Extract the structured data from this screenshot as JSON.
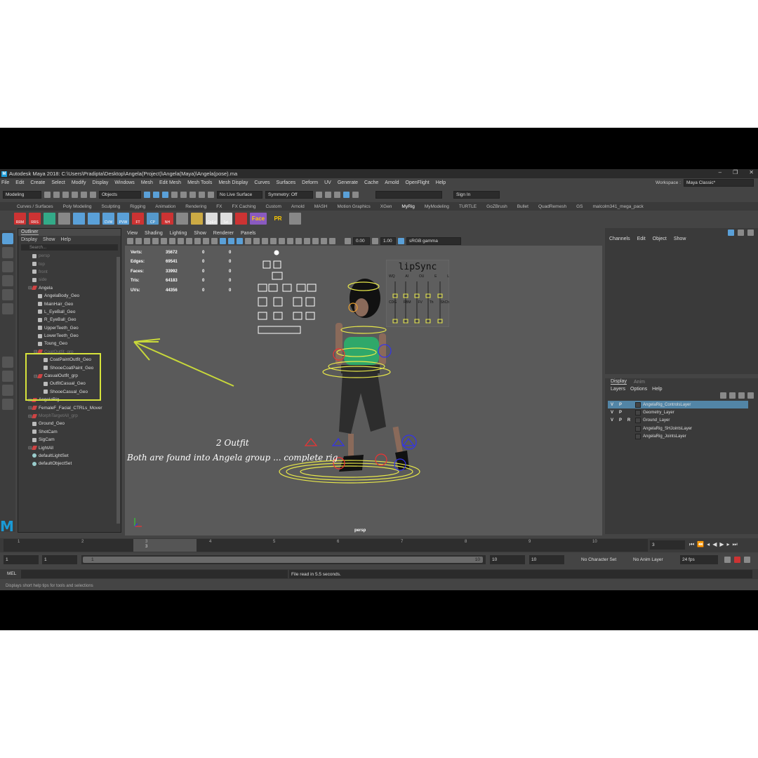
{
  "window": {
    "title": "Autodesk Maya 2018: C:\\Users\\Pradipta\\Desktop\\Angela(Project)\\Angela(Maya)\\Angela(pose).ma",
    "logo": "M"
  },
  "menus": [
    "File",
    "Edit",
    "Create",
    "Select",
    "Modify",
    "Display",
    "Windows",
    "Mesh",
    "Edit Mesh",
    "Mesh Tools",
    "Mesh Display",
    "Curves",
    "Surfaces",
    "Deform",
    "UV",
    "Generate",
    "Cache",
    "Arnold",
    "OpenFlight",
    "Help"
  ],
  "workspace": {
    "label": "Workspace :",
    "value": "Maya Classic*"
  },
  "status": {
    "mode": "Modeling",
    "objects": "Objects",
    "live_surface": "No Live Surface",
    "symmetry": "Symmetry: Off",
    "signin": "Sign In"
  },
  "shelf_tabs": [
    "Curves / Surfaces",
    "Poly Modeling",
    "Sculpting",
    "Rigging",
    "Animation",
    "Rendering",
    "FX",
    "FX Caching",
    "Custom",
    "Arnold",
    "MASH",
    "Motion Graphics",
    "XGen",
    "MyRig",
    "MyModeling",
    "TURTLE",
    "GoZBrush",
    "Bullet",
    "QuadRemesh",
    "GS",
    "malcolm341_mega_pack"
  ],
  "shelf_active": "MyRig",
  "shelf_buttons": [
    "RRM",
    "RRS",
    "",
    "",
    "",
    "",
    "CVW",
    "PVW",
    "FT",
    "CP",
    "NH",
    "",
    "",
    "CpEd",
    "Sel.",
    "",
    "Face",
    "PR",
    ""
  ],
  "outliner": {
    "title": "Outliner",
    "menu": [
      "Display",
      "Show",
      "Help"
    ],
    "search_placeholder": "Search...",
    "items": [
      {
        "label": "persp",
        "dim": true,
        "indent": 1,
        "kind": "cam"
      },
      {
        "label": "top",
        "dim": true,
        "indent": 1,
        "kind": "cam"
      },
      {
        "label": "front",
        "dim": true,
        "indent": 1,
        "kind": "cam"
      },
      {
        "label": "side",
        "dim": true,
        "indent": 1,
        "kind": "cam"
      },
      {
        "label": "Angela",
        "dim": false,
        "indent": 1,
        "kind": "grp"
      },
      {
        "label": "AngelaBody_Geo",
        "dim": false,
        "indent": 2,
        "kind": "geo"
      },
      {
        "label": "MainHair_Geo",
        "dim": false,
        "indent": 2,
        "kind": "geo"
      },
      {
        "label": "L_EyeBall_Geo",
        "dim": false,
        "indent": 2,
        "kind": "geo"
      },
      {
        "label": "R_EyeBall_Geo",
        "dim": false,
        "indent": 2,
        "kind": "geo"
      },
      {
        "label": "UpperTeeth_Geo",
        "dim": false,
        "indent": 2,
        "kind": "geo"
      },
      {
        "label": "LowerTeeth_Geo",
        "dim": false,
        "indent": 2,
        "kind": "geo"
      },
      {
        "label": "Toung_Geo",
        "dim": false,
        "indent": 2,
        "kind": "geo"
      },
      {
        "label": "CoatOutfit_grp",
        "dim": true,
        "indent": 2,
        "kind": "grp"
      },
      {
        "label": "CoatPaintOutfit_Geo",
        "dim": false,
        "indent": 3,
        "kind": "geo"
      },
      {
        "label": "ShooeCoatPaint_Geo",
        "dim": false,
        "indent": 3,
        "kind": "geo"
      },
      {
        "label": "CasualOutfit_grp",
        "dim": false,
        "indent": 2,
        "kind": "grp"
      },
      {
        "label": "OutfitCasual_Geo",
        "dim": false,
        "indent": 3,
        "kind": "geo"
      },
      {
        "label": "ShooeCasual_Geo",
        "dim": false,
        "indent": 3,
        "kind": "geo"
      },
      {
        "label": "AngelaRig",
        "dim": false,
        "indent": 1,
        "kind": "grp"
      },
      {
        "label": "FemaleF_Facial_CTRLs_Mover",
        "dim": false,
        "indent": 1,
        "kind": "grp"
      },
      {
        "label": "MorphTargetAll_grp",
        "dim": true,
        "indent": 1,
        "kind": "grp"
      },
      {
        "label": "Ground_Geo",
        "dim": false,
        "indent": 1,
        "kind": "geo"
      },
      {
        "label": "ShotCam",
        "dim": false,
        "indent": 1,
        "kind": "cam"
      },
      {
        "label": "SigCam",
        "dim": false,
        "indent": 1,
        "kind": "cam"
      },
      {
        "label": "LightAll",
        "dim": false,
        "indent": 1,
        "kind": "grp"
      },
      {
        "label": "defaultLightSet",
        "dim": false,
        "indent": 1,
        "kind": "set"
      },
      {
        "label": "defaultObjectSet",
        "dim": false,
        "indent": 1,
        "kind": "set"
      }
    ]
  },
  "viewport": {
    "menu": [
      "View",
      "Shading",
      "Lighting",
      "Show",
      "Renderer",
      "Panels"
    ],
    "exposure": "0.00",
    "gamma": "1.00",
    "colorspace": "sRGB gamma",
    "hud": [
      {
        "label": "Verts:",
        "a": "35672",
        "b": "0",
        "c": "0"
      },
      {
        "label": "Edges:",
        "a": "69541",
        "b": "0",
        "c": "0"
      },
      {
        "label": "Faces:",
        "a": "33992",
        "b": "0",
        "c": "0"
      },
      {
        "label": "Tris:",
        "a": "64183",
        "b": "0",
        "c": "0"
      },
      {
        "label": "UVs:",
        "a": "44356",
        "b": "0",
        "c": "0"
      }
    ],
    "camera": "persp",
    "note_outfit": "2 Outfit",
    "note_group": "Both are found into Angela group ... complete  rig",
    "lipsync": {
      "title": "lipSync",
      "cols_top": [
        "WQ",
        "AI",
        "OU",
        "E",
        "L"
      ],
      "cols_bottom": [
        "CDG",
        "FBM",
        "FV",
        "Th",
        "ShCh"
      ]
    }
  },
  "channel_box": {
    "menu": [
      "Channels",
      "Edit",
      "Object",
      "Show"
    ]
  },
  "layer_editor": {
    "tabs": [
      "Display",
      "Anim"
    ],
    "menu": [
      "Layers",
      "Options",
      "Help"
    ],
    "layers": [
      {
        "v": "V",
        "p": "P",
        "r": "",
        "name": "AngelaRig_ControlsLayer",
        "selected": true
      },
      {
        "v": "V",
        "p": "P",
        "r": "",
        "name": "Geometry_Layer",
        "selected": false
      },
      {
        "v": "V",
        "p": "P",
        "r": "R",
        "name": "Ground_Layer",
        "selected": false
      },
      {
        "v": "",
        "p": "",
        "r": "",
        "name": "AngelaRig_SHJointsLayer",
        "selected": false
      },
      {
        "v": "",
        "p": "",
        "r": "",
        "name": "AngelaRig_JointsLayer",
        "selected": false
      }
    ]
  },
  "timeline": {
    "ticks": [
      "1",
      "2",
      "3",
      "4",
      "5",
      "6",
      "7",
      "8",
      "9",
      "10"
    ],
    "current_marker": "3",
    "current_frame": "3",
    "start": "1",
    "start2": "1",
    "range_start": "1",
    "range_end": "10",
    "end": "10",
    "end2": "10",
    "char_set": "No Character Set",
    "anim_layer": "No Anim Layer",
    "fps": "24 fps"
  },
  "command_line": {
    "label": "MEL",
    "result": "File read in  5.5 seconds."
  },
  "help_line": "Displays short help tips for tools and selections"
}
